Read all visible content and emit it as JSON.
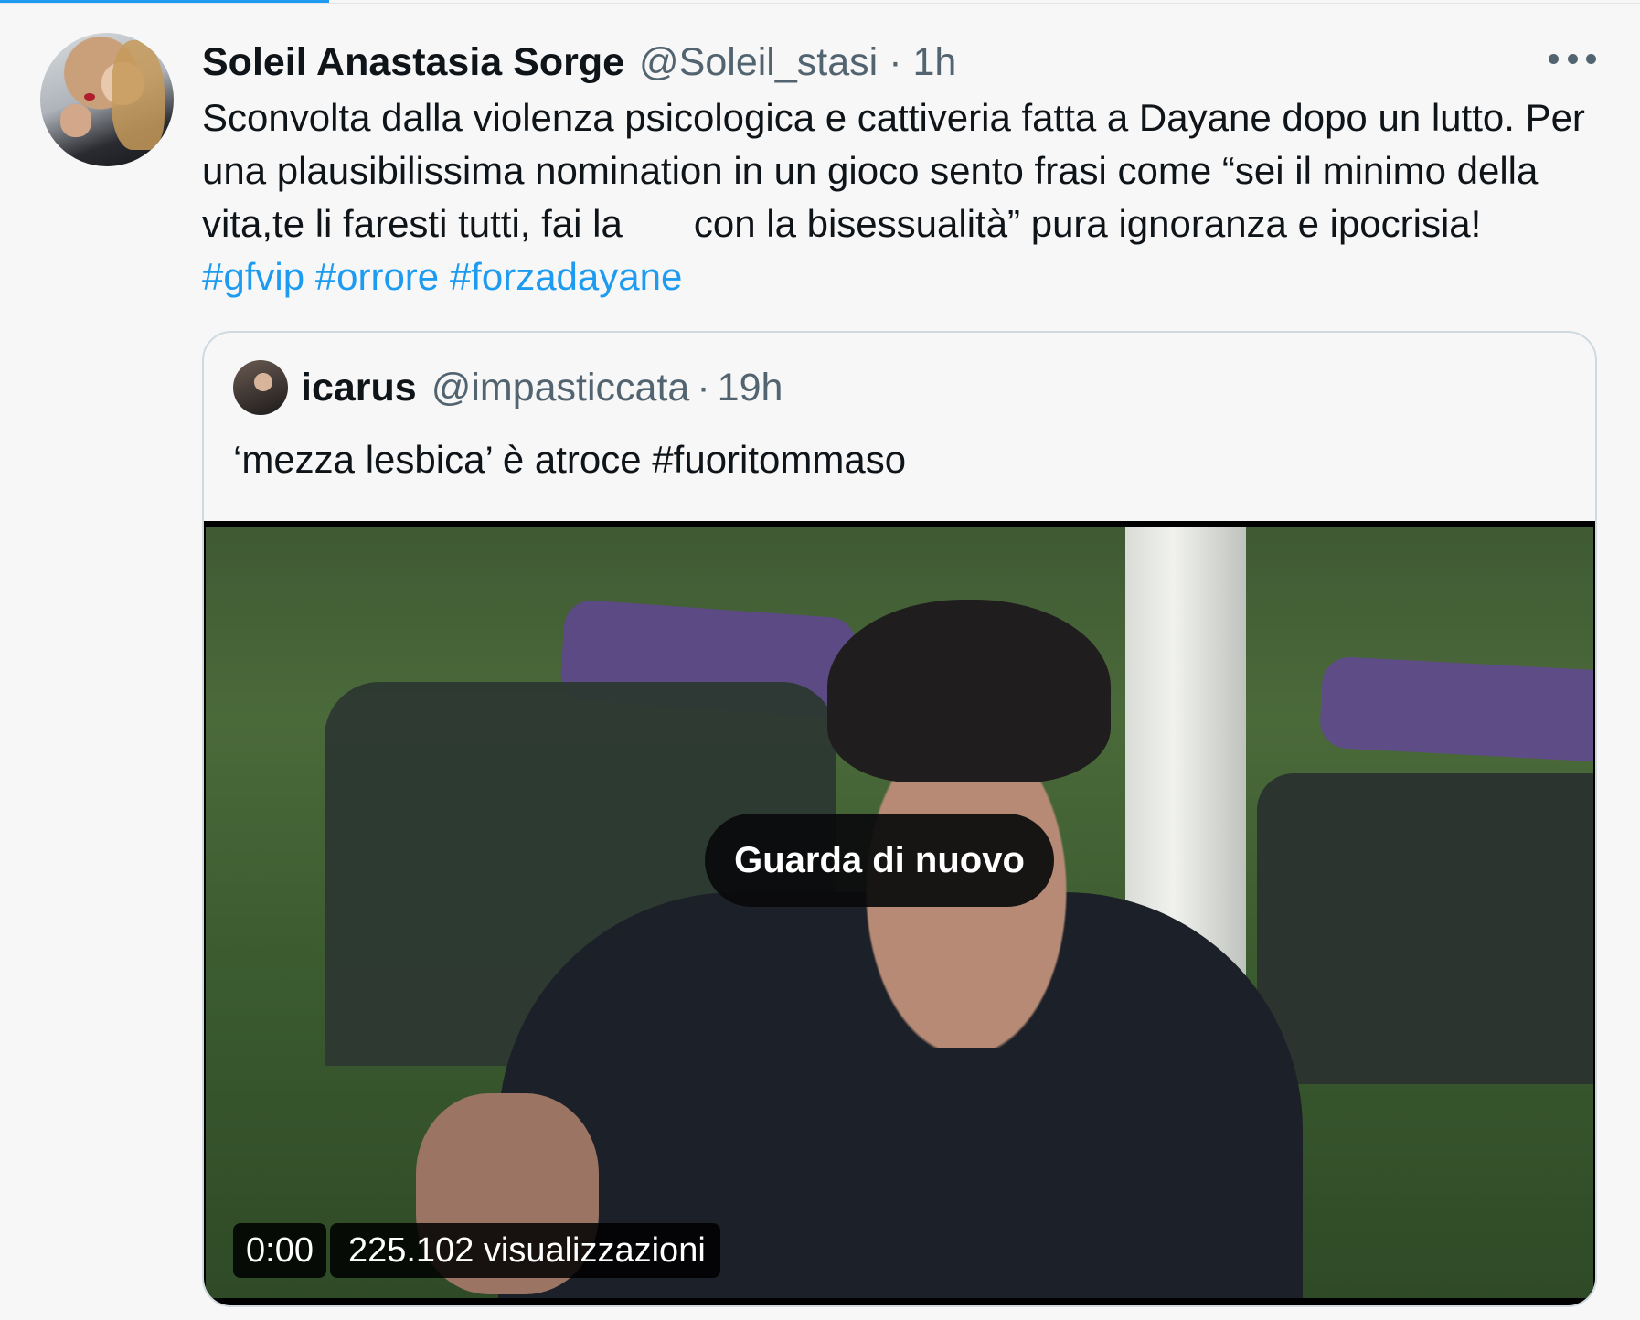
{
  "tweet": {
    "author_name": "Soleil Anastasia Sorge",
    "author_handle": "@Soleil_stasi",
    "separator": "·",
    "time": "1h",
    "text_part1": "Sconvolta dalla violenza psicologica e cattiveria fatta a Dayane dopo un lutto. Per una plausibilissima nomination in un gioco sento frasi come “sei il minimo della vita,te li faresti tutti, fai la",
    "text_part2": "con la bisessualità” pura ignoranza e ipocrisia! ",
    "hashtags": [
      "#gfvip",
      "#orrore",
      "#forzadayane"
    ],
    "link_color": "#1d9bf0"
  },
  "quoted": {
    "author_name": "icarus",
    "author_handle": "@impasticcata",
    "separator": "·",
    "time": "19h",
    "text": "‘mezza lesbica’ è atroce #fuoritommaso"
  },
  "video": {
    "replay_label": "Guarda di nuovo",
    "timecode": "0:00",
    "views": "225.102 visualizzazioni"
  },
  "icons": {
    "more": "more-horizontal-icon"
  }
}
